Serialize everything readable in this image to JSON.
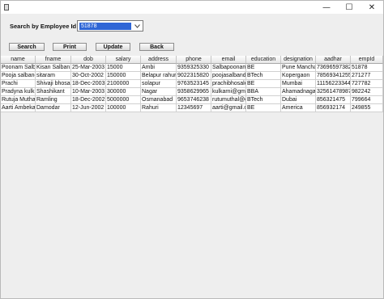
{
  "window": {
    "minimize_glyph": "—",
    "maximize_glyph": "☐",
    "close_glyph": "✕"
  },
  "search": {
    "label": "Search by Employee Id",
    "selected_value": "51878"
  },
  "buttons": {
    "search": "Search",
    "print": "Print",
    "update": "Update",
    "back": "Back"
  },
  "table": {
    "columns": [
      "name",
      "fname",
      "dob",
      "salary",
      "address",
      "phone",
      "email",
      "education",
      "designation",
      "aadhar",
      "empId"
    ],
    "rows": [
      [
        "Poonam Salb...",
        "Kisan Salban...",
        "25-Mar-2003",
        "15000",
        "Ambi",
        "9359325330",
        "Salbapoonam...",
        "BE",
        "Pune Manchar",
        "736965973828",
        "51878"
      ],
      [
        "Pooja salband",
        "sitaram",
        "30-Oct-2002",
        "150000",
        "Belapur rahuri",
        "9022315820",
        "poojasalband...",
        "BTech",
        "Kopergaon",
        "78569341255",
        "271277"
      ],
      [
        "Prachi",
        "Shivaji bhosa...",
        "18-Dec-2003",
        "2100000",
        "solapur",
        "9763523145",
        "prachibhosale...",
        "BE",
        "Mumbai",
        "11156223344",
        "727782"
      ],
      [
        "Pradyna kulk...",
        "Shashikant",
        "10-Mar-2003",
        "300000",
        "Nagar",
        "9358629965",
        "kulkarni@gm...",
        "BBA",
        "Ahamadnagar",
        "325614789874",
        "982242"
      ],
      [
        "Rutuja Muthal",
        "Ramling",
        "18-Dec-2002",
        "5000000",
        "Osmanabad",
        "9653746238",
        "rutumuthal@g...",
        "BTech",
        "Dubai",
        "856321475",
        "799664"
      ],
      [
        "Aarti Ambekar",
        "Damodar",
        "12-Jun-2002",
        "100000",
        "Rahuri",
        "12345697",
        "aarti@gmail.c...",
        "BE",
        "America",
        "856932174",
        "249855"
      ]
    ]
  }
}
